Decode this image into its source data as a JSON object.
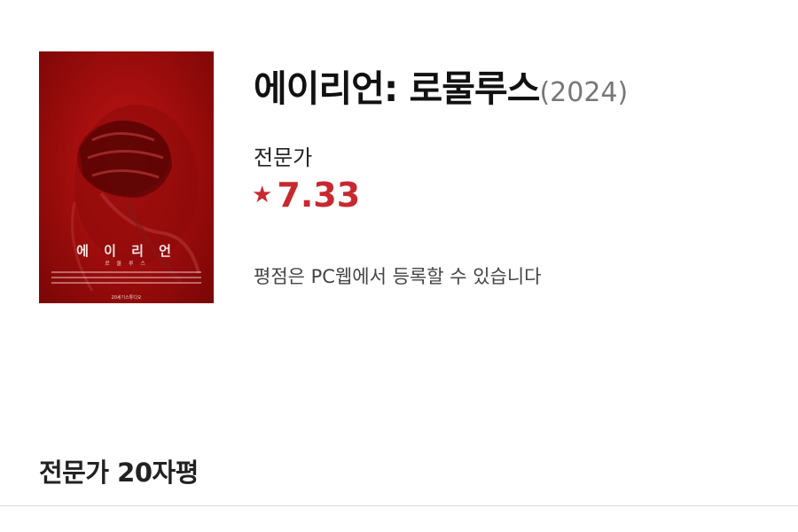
{
  "movie": {
    "title": "에이리언: 로물루스",
    "year": "(2024)",
    "poster": {
      "title_text": "에 이 리 언",
      "subtitle_text": "로 물 루 스",
      "bottom_text": "20세기스튜디오"
    }
  },
  "rating": {
    "label": "전문가",
    "star_icon": "★",
    "value": "7.33",
    "color": "#c8282f"
  },
  "notice": "평점은 PC웹에서 등록할 수 있습니다",
  "section": {
    "title": "전문가 20자평"
  }
}
